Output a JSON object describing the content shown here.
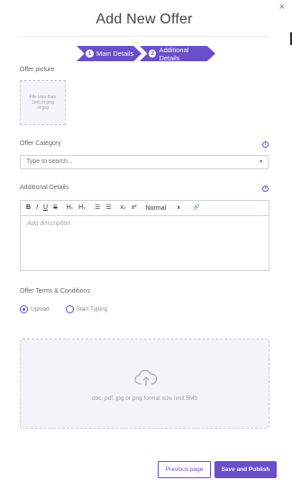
{
  "header": {
    "title": "Add New Offer",
    "close_icon": "close-icon",
    "close_glyph": "×"
  },
  "steps": [
    {
      "number": "1",
      "label": "Main Details"
    },
    {
      "number": "2",
      "label": "Additional Details"
    }
  ],
  "offer_picture": {
    "label": "Offer picture",
    "hint": "File less than 1mb in png or jpg"
  },
  "offer_category": {
    "label": "Offer Category",
    "placeholder": "Type to search...",
    "caret_glyph": "▾"
  },
  "additional_details": {
    "label": "Additional Details",
    "toolbar": {
      "bold": "B",
      "italic": "I",
      "underline": "U",
      "strike": "S",
      "h1": "H₁",
      "h2": "H₂",
      "ordered_list": "☰",
      "bullet_list": "☰",
      "subscript": "x₂",
      "superscript": "x²",
      "format": "Normal",
      "format_arrows": "⬍",
      "link": "🔗"
    },
    "placeholder": "Add description"
  },
  "terms": {
    "label": "Offer Terms & Conditions",
    "options": [
      {
        "label": "Upload",
        "selected": true
      },
      {
        "label": "Start Typing",
        "selected": false
      }
    ],
    "dropzone_text": "doc, pdf, jpg or png format size limit 5Mb",
    "dropzone_icon": "cloud-upload-icon"
  },
  "footer": {
    "previous_label": "Previous page",
    "save_label": "Save and Publish"
  },
  "colors": {
    "accent": "#6a4fc8",
    "dropzone_bg": "#f2f4f7"
  }
}
